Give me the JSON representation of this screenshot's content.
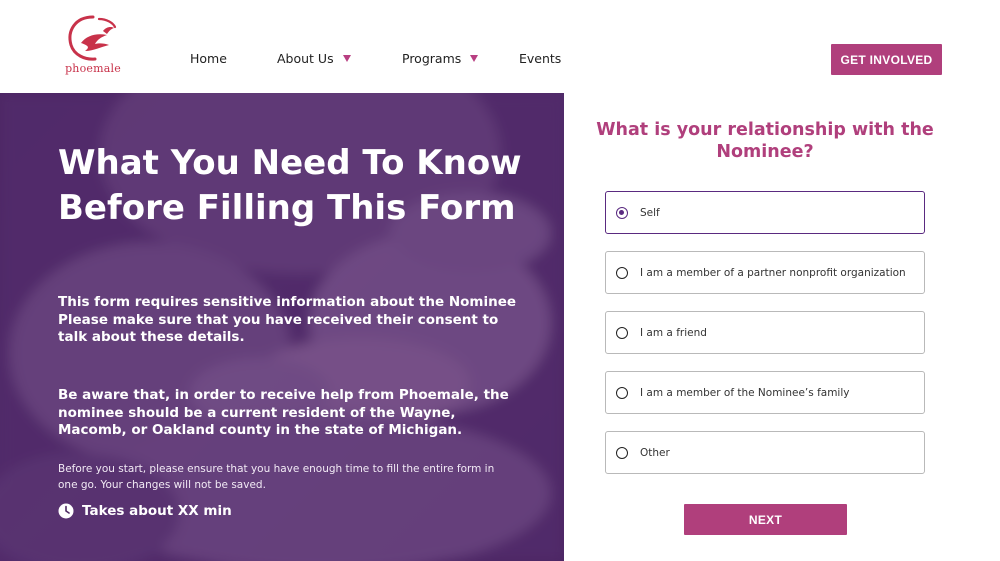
{
  "header": {
    "logo_text": "phoemale",
    "nav": [
      {
        "label": "Home",
        "has_dropdown": false
      },
      {
        "label": "About Us",
        "has_dropdown": true
      },
      {
        "label": "Programs",
        "has_dropdown": true
      },
      {
        "label": "Events",
        "has_dropdown": false
      }
    ],
    "cta_label": "GET INVOLVED"
  },
  "hero": {
    "title": "What You Need To Know Before Filling This Form",
    "paragraph1": "This form requires sensitive information about the Nominee Please make sure that you have received their consent to talk about these details.",
    "paragraph2": "Be aware that, in order to receive help from Phoemale, the nominee should be a current resident of the Wayne, Macomb, or Oakland county in the state of Michigan.",
    "note": "Before you start, please ensure that you have enough time to fill the entire form in one go. Your changes will not be saved.",
    "time_label": "Takes about XX min",
    "time_icon": "clock-icon"
  },
  "form": {
    "question": "What is your relationship with the Nominee?",
    "options": [
      {
        "label": "Self",
        "selected": true
      },
      {
        "label": "I am a member of a partner nonprofit organization",
        "selected": false
      },
      {
        "label": "I am a friend",
        "selected": false
      },
      {
        "label": "I am a member of the Nominee’s family",
        "selected": false
      },
      {
        "label": "Other",
        "selected": false
      }
    ],
    "next_label": "NEXT"
  },
  "colors": {
    "brand": "#b03f7c",
    "hero_purple": "#4d2a63",
    "selected_border": "#5a2a80",
    "logo_red": "#c8324a"
  }
}
